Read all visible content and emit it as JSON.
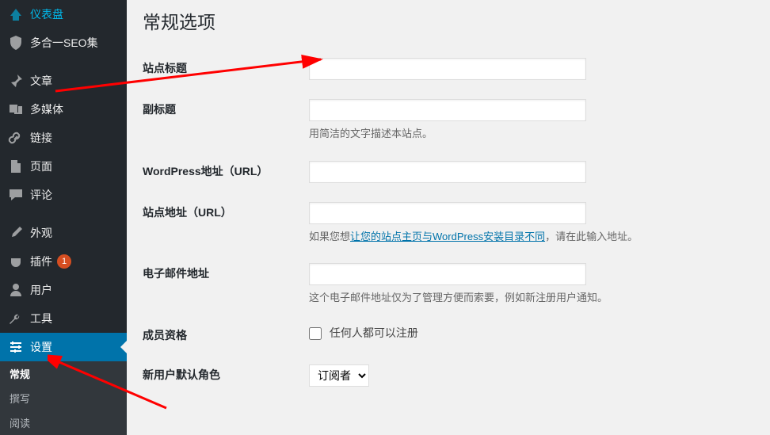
{
  "sidebar": {
    "items": [
      {
        "label": "仪表盘",
        "icon": "dashboard"
      },
      {
        "label": "多合一SEO集",
        "icon": "seo"
      },
      {
        "label": "文章",
        "icon": "posts"
      },
      {
        "label": "多媒体",
        "icon": "media"
      },
      {
        "label": "链接",
        "icon": "links"
      },
      {
        "label": "页面",
        "icon": "pages"
      },
      {
        "label": "评论",
        "icon": "comments"
      },
      {
        "label": "外观",
        "icon": "appearance"
      },
      {
        "label": "插件",
        "icon": "plugins",
        "badge": "1"
      },
      {
        "label": "用户",
        "icon": "users"
      },
      {
        "label": "工具",
        "icon": "tools"
      },
      {
        "label": "设置",
        "icon": "settings",
        "current": true
      }
    ],
    "submenu": [
      {
        "label": "常规",
        "active": true
      },
      {
        "label": "撰写"
      },
      {
        "label": "阅读"
      }
    ]
  },
  "page": {
    "title": "常规选项"
  },
  "form": {
    "site_title": {
      "label": "站点标题",
      "value": ""
    },
    "tagline": {
      "label": "副标题",
      "value": "",
      "desc": "用简洁的文字描述本站点。"
    },
    "wp_url": {
      "label": "WordPress地址（URL）",
      "value": ""
    },
    "site_url": {
      "label": "站点地址（URL）",
      "value": "",
      "desc_prefix": "如果您想",
      "desc_link": "让您的站点主页与WordPress安装目录不同",
      "desc_suffix": "，请在此输入地址。"
    },
    "email": {
      "label": "电子邮件地址",
      "value": "",
      "desc": "这个电子邮件地址仅为了管理方便而索要，例如新注册用户通知。"
    },
    "membership": {
      "label": "成员资格",
      "checkbox_label": "任何人都可以注册",
      "checked": false
    },
    "default_role": {
      "label": "新用户默认角色",
      "selected": "订阅者",
      "options": [
        "订阅者"
      ]
    }
  }
}
